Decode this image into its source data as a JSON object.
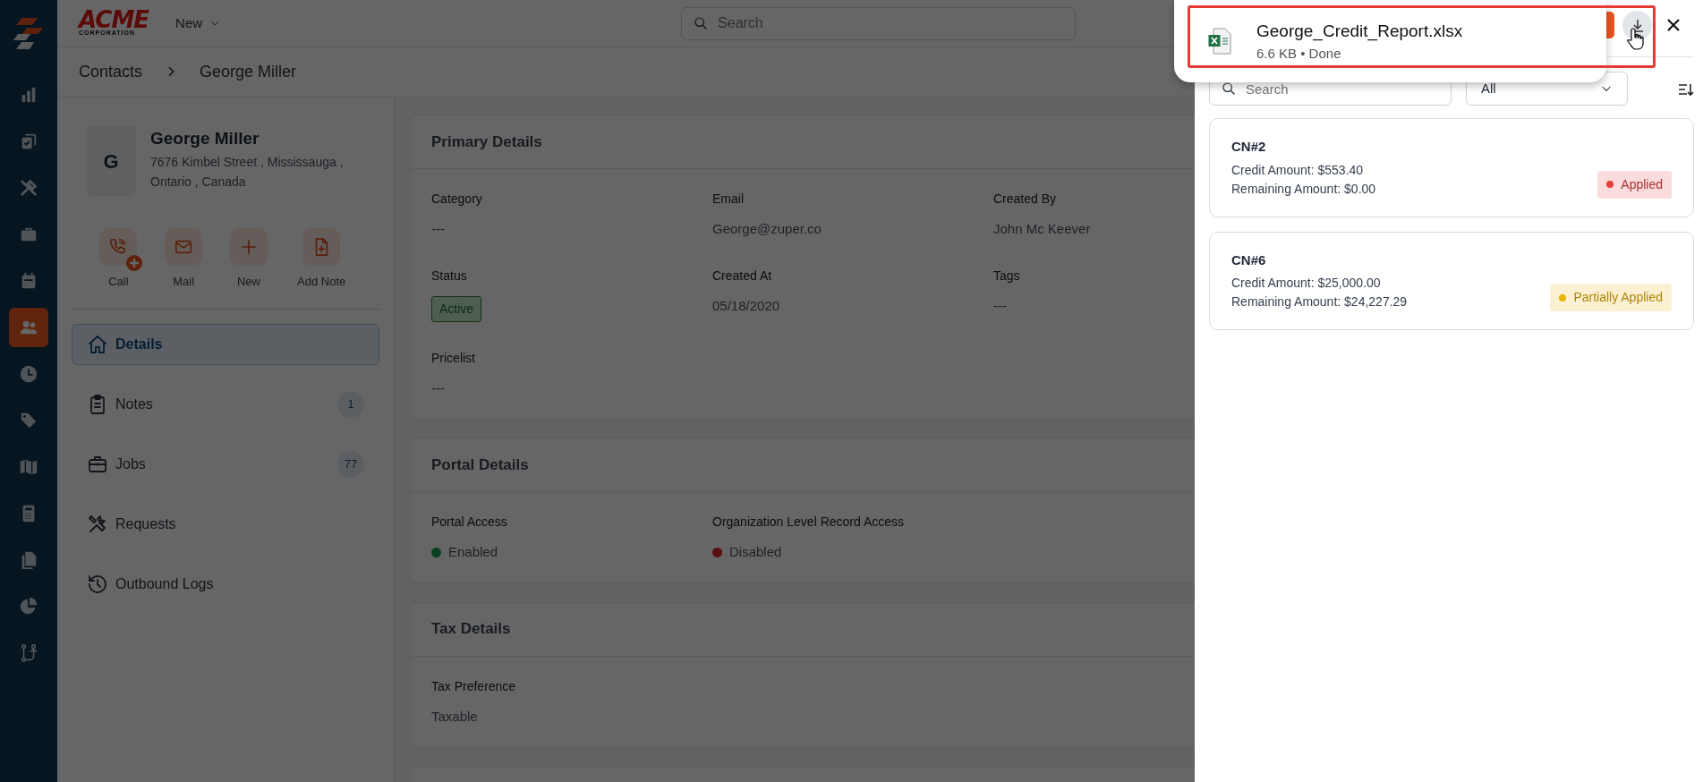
{
  "top_bar": {
    "logo": {
      "word": "ACME",
      "tagline": "CORPORATION"
    },
    "new_menu": "New",
    "search": {
      "placeholder": "Search"
    }
  },
  "nav_rail": [
    {
      "selected": false
    },
    {
      "selected": false
    },
    {
      "selected": false
    },
    {
      "selected": false
    },
    {
      "selected": false
    },
    {
      "selected": true
    },
    {
      "selected": false
    },
    {
      "selected": false
    },
    {
      "selected": false
    },
    {
      "selected": false
    },
    {
      "selected": false
    },
    {
      "selected": false
    },
    {
      "selected": false
    }
  ],
  "breadcrumb": [
    "Contacts",
    "George Miller"
  ],
  "contact": {
    "initial": "G",
    "name": "George Miller",
    "address": "7676 Kimbel Street , Mississauga , Ontario , Canada"
  },
  "actions": [
    {
      "label": "Call"
    },
    {
      "label": "Mail"
    },
    {
      "label": "New"
    },
    {
      "label": "Add Note"
    }
  ],
  "menu": [
    {
      "label": "Details",
      "selected": true
    },
    {
      "label": "Notes",
      "count": "1",
      "selected": false
    },
    {
      "label": "Jobs",
      "count": "77",
      "selected": false
    },
    {
      "label": "Requests",
      "selected": false
    },
    {
      "label": "Outbound Logs",
      "selected": false
    }
  ],
  "sections": [
    {
      "title": "Primary Details",
      "fields": [
        {
          "label": "Category",
          "value": "---",
          "kind": "text"
        },
        {
          "label": "Email",
          "value": "George@zuper.co",
          "kind": "text"
        },
        {
          "label": "Created By",
          "value": "John Mc Keever",
          "kind": "text"
        },
        {
          "label": "Status",
          "value": "Active",
          "kind": "badge"
        },
        {
          "label": "Created At",
          "value": "05/18/2020",
          "kind": "text"
        },
        {
          "label": "Tags",
          "value": "---",
          "kind": "text"
        },
        {
          "label": "Pricelist",
          "value": "---",
          "kind": "text"
        }
      ]
    },
    {
      "title": "Portal Details",
      "fields": [
        {
          "label": "Portal Access",
          "value": "Enabled",
          "kind": "status",
          "enabled": true
        },
        {
          "label": "Organization Level Record Access",
          "value": "Disabled",
          "kind": "status",
          "enabled": false
        }
      ]
    },
    {
      "title": "Tax Details",
      "fields": [
        {
          "label": "Tax Preference",
          "value": "Taxable",
          "kind": "text"
        }
      ]
    }
  ],
  "drawer": {
    "search": {
      "placeholder": "Search"
    },
    "filter": "All",
    "credit_notes": [
      {
        "title": "CN#2",
        "credit": "Credit Amount: $553.40",
        "remaining": "Remaining Amount: $0.00",
        "status": {
          "label": "Applied",
          "color": "#e53e3e"
        }
      },
      {
        "title": "CN#6",
        "credit": "Credit Amount: $25,000.00",
        "remaining": "Remaining Amount: $24,227.29",
        "status": {
          "label": "Partially Applied",
          "color": "#eab308"
        }
      }
    ]
  },
  "download": {
    "filename": "George_Credit_Report.xlsx",
    "details": "6.6 KB • Done"
  }
}
